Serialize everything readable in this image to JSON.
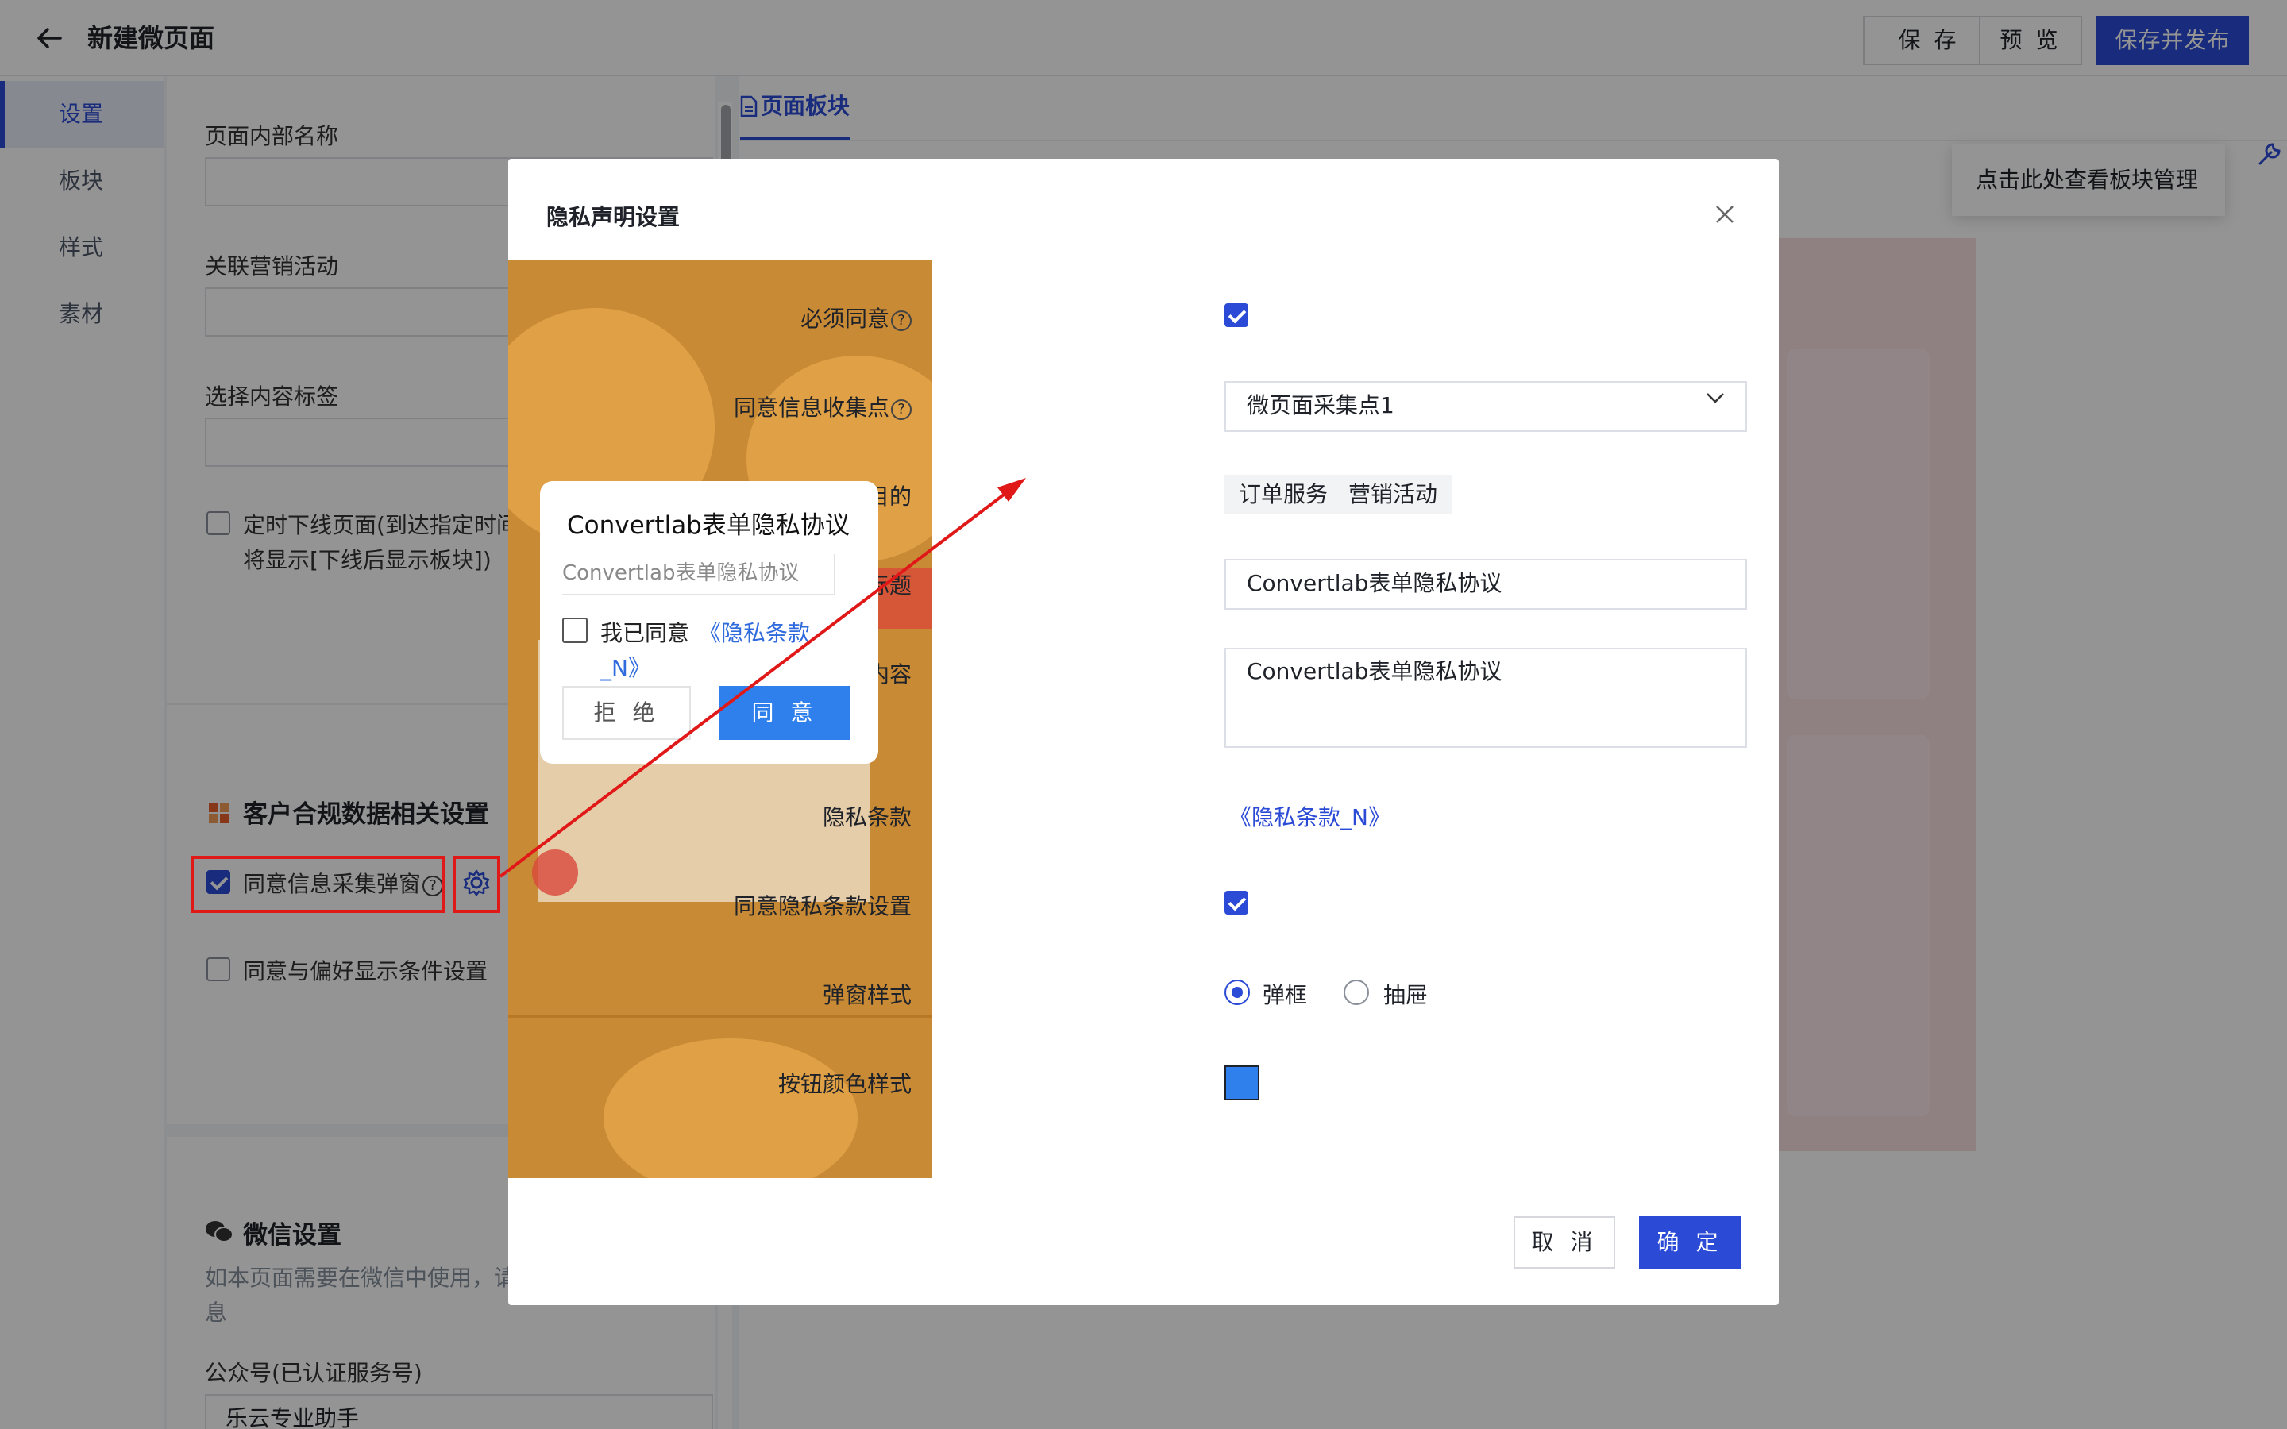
{
  "header": {
    "title": "新建微页面",
    "save_label": "保 存",
    "preview_label": "预 览",
    "publish_label": "保存并发布"
  },
  "sidebar": {
    "items": [
      {
        "label": "设置"
      },
      {
        "label": "板块"
      },
      {
        "label": "样式"
      },
      {
        "label": "素材"
      }
    ]
  },
  "settings": {
    "internal_name_label": "页面内部名称",
    "campaign_label": "关联营销活动",
    "content_tag_label": "选择内容标签",
    "offline_text_1": "定时下线页面(到达指定时间",
    "offline_text_2": "将显示[下线后显示板块])",
    "compliance_title": "客户合规数据相关设置",
    "consent_popup_label": "同意信息采集弹窗",
    "preference_label": "同意与偏好显示条件设置",
    "wechat_title": "微信设置",
    "wechat_desc_1": "如本页面需要在微信中使用，请",
    "wechat_desc_2": "息",
    "account_label": "公众号(已认证服务号)",
    "account_value": "乐云专业助手"
  },
  "canvas": {
    "tab_label": "页面板块",
    "tip_text": "点击此处查看板块管理"
  },
  "modal": {
    "title": "隐私声明设置",
    "preview": {
      "dialog_title": "Convertlab表单隐私协议",
      "input_text": "Convertlab表单隐私协议",
      "agree_text": "我已同意",
      "link_text_1": "《隐私条款",
      "link_text_2": "_N》",
      "reject_label": "拒 绝",
      "accept_label": "同 意"
    },
    "form": {
      "must_agree_label": "必须同意",
      "collection_point_label": "同意信息收集点",
      "collection_point_value": "微页面采集点1",
      "purpose_label": "业务目的",
      "purpose_tags": [
        "订单服务",
        "营销活动"
      ],
      "privacy_title_label": "隐私声明标题",
      "privacy_title_value": "Convertlab表单隐私协议",
      "privacy_content_label": "隐私声明内容",
      "privacy_content_value": "Convertlab表单隐私协议",
      "privacy_terms_label": "隐私条款",
      "privacy_terms_link": "《隐私条款_N》",
      "terms_setting_label": "同意隐私条款设置",
      "popup_style_label": "弹窗样式",
      "popup_style_options": [
        "弹框",
        "抽屉"
      ],
      "popup_style_selected": "弹框",
      "button_color_label": "按钮颜色样式",
      "button_color": "#2f80ed"
    },
    "cancel_label": "取 消",
    "ok_label": "确 定"
  },
  "colors": {
    "primary": "#2b4bd6",
    "annotation": "#e01818"
  }
}
